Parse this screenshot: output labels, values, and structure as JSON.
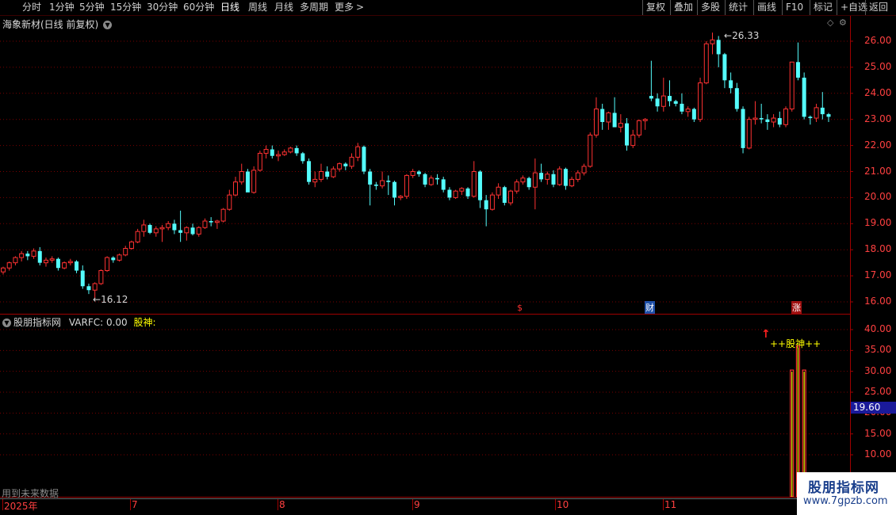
{
  "toolbar": {
    "periods": [
      "分时",
      "1分钟",
      "5分钟",
      "15分钟",
      "30分钟",
      "60分钟",
      "日线",
      "周线",
      "月线",
      "多周期",
      "更多"
    ],
    "active_period": "日线",
    "more_arrow": ">",
    "right_buttons": [
      "复权",
      "叠加",
      "多股",
      "统计",
      "画线",
      "F10",
      "+自选",
      "返回"
    ],
    "secondary_button": "标记"
  },
  "main_chart": {
    "title": "海象新材(日线 前复权)",
    "high_label": "26.33",
    "low_label": "16.12",
    "y_ticks": [
      "26.00",
      "25.00",
      "24.00",
      "23.00",
      "22.00",
      "21.00",
      "20.00",
      "19.00",
      "18.00",
      "17.00",
      "16.00"
    ],
    "event_markers": [
      "$",
      "财",
      "涨"
    ]
  },
  "indicator": {
    "title": "股朋指标网",
    "varfc": "VARFC: 0.00",
    "gushen_label": "股神:",
    "signal_text": "++股神++",
    "y_ticks": [
      "40.00",
      "35.00",
      "30.00",
      "25.00",
      "20.00",
      "15.00",
      "10.00"
    ],
    "current_value": "19.60",
    "footer_note": "用到未来数据"
  },
  "x_axis": {
    "labels": [
      "2025年",
      "7",
      "8",
      "9",
      "10",
      "11"
    ]
  },
  "watermark": {
    "title": "股朋指标网",
    "url": "www.7gpzb.com"
  },
  "colors": {
    "up": "#ff3232",
    "down": "#54fcfc",
    "grid": "#7a0000",
    "axis": "#a00000",
    "yellow": "#ffff00",
    "signal_bar": "#ff3232"
  },
  "chart_data": {
    "type": "candlestick",
    "ylim": [
      15.6,
      26.7
    ],
    "ohlc": [
      [
        17.15,
        17.35,
        17.05,
        17.3
      ],
      [
        17.3,
        17.55,
        17.2,
        17.5
      ],
      [
        17.5,
        17.75,
        17.4,
        17.7
      ],
      [
        17.7,
        17.95,
        17.55,
        17.85
      ],
      [
        17.85,
        17.95,
        17.6,
        17.75
      ],
      [
        17.75,
        18.05,
        17.65,
        17.95
      ],
      [
        17.95,
        18.1,
        17.4,
        17.5
      ],
      [
        17.5,
        17.7,
        17.35,
        17.6
      ],
      [
        17.6,
        17.75,
        17.5,
        17.65
      ],
      [
        17.65,
        17.7,
        17.2,
        17.3
      ],
      [
        17.3,
        17.55,
        17.25,
        17.5
      ],
      [
        17.5,
        17.65,
        17.4,
        17.55
      ],
      [
        17.55,
        17.6,
        17.1,
        17.2
      ],
      [
        17.2,
        17.4,
        16.5,
        16.6
      ],
      [
        16.6,
        16.7,
        16.3,
        16.45
      ],
      [
        16.45,
        16.75,
        16.12,
        16.7
      ],
      [
        16.7,
        17.25,
        16.65,
        17.2
      ],
      [
        17.2,
        17.75,
        17.15,
        17.7
      ],
      [
        17.7,
        17.75,
        17.5,
        17.6
      ],
      [
        17.6,
        17.85,
        17.55,
        17.8
      ],
      [
        17.8,
        18.15,
        17.75,
        18.05
      ],
      [
        18.05,
        18.35,
        18.0,
        18.3
      ],
      [
        18.3,
        18.8,
        18.25,
        18.7
      ],
      [
        18.7,
        19.15,
        18.5,
        18.95
      ],
      [
        18.95,
        19.0,
        18.6,
        18.65
      ],
      [
        18.65,
        18.9,
        18.5,
        18.8
      ],
      [
        18.8,
        18.95,
        18.3,
        18.85
      ],
      [
        18.85,
        19.1,
        18.75,
        19.0
      ],
      [
        19.0,
        19.15,
        18.6,
        18.75
      ],
      [
        18.75,
        19.5,
        18.3,
        18.65
      ],
      [
        18.65,
        18.9,
        18.35,
        18.85
      ],
      [
        18.85,
        19.0,
        18.55,
        18.6
      ],
      [
        18.6,
        18.9,
        18.5,
        18.85
      ],
      [
        18.85,
        19.2,
        18.8,
        19.1
      ],
      [
        19.1,
        19.25,
        18.9,
        19.05
      ],
      [
        19.05,
        19.15,
        18.8,
        19.1
      ],
      [
        19.1,
        19.6,
        19.05,
        19.55
      ],
      [
        19.55,
        20.3,
        19.5,
        20.1
      ],
      [
        20.1,
        20.8,
        20.05,
        20.6
      ],
      [
        20.6,
        21.3,
        20.5,
        21.0
      ],
      [
        21.0,
        21.1,
        20.5,
        20.2
      ],
      [
        20.2,
        21.2,
        20.15,
        21.05
      ],
      [
        21.05,
        21.8,
        21.0,
        21.7
      ],
      [
        21.7,
        22.0,
        21.5,
        21.85
      ],
      [
        21.85,
        22.0,
        21.5,
        21.6
      ],
      [
        21.6,
        21.8,
        21.4,
        21.65
      ],
      [
        21.65,
        21.85,
        21.6,
        21.75
      ],
      [
        21.75,
        21.95,
        21.7,
        21.9
      ],
      [
        21.9,
        22.0,
        21.6,
        21.7
      ],
      [
        21.7,
        21.75,
        21.3,
        21.4
      ],
      [
        21.4,
        21.5,
        20.5,
        20.6
      ],
      [
        20.6,
        21.0,
        20.4,
        20.7
      ],
      [
        20.7,
        21.3,
        20.6,
        21.0
      ],
      [
        21.0,
        21.2,
        20.7,
        20.8
      ],
      [
        20.8,
        21.2,
        20.75,
        21.1
      ],
      [
        21.1,
        21.35,
        21.0,
        21.3
      ],
      [
        21.3,
        21.35,
        21.05,
        21.2
      ],
      [
        21.2,
        21.7,
        21.1,
        21.55
      ],
      [
        21.55,
        22.1,
        21.4,
        21.95
      ],
      [
        21.95,
        22.0,
        20.9,
        21.0
      ],
      [
        21.0,
        21.1,
        19.7,
        20.5
      ],
      [
        20.5,
        20.6,
        20.3,
        20.45
      ],
      [
        20.45,
        21.0,
        20.35,
        20.65
      ],
      [
        20.65,
        20.85,
        20.1,
        20.6
      ],
      [
        20.6,
        20.65,
        19.7,
        20.0
      ],
      [
        20.0,
        20.1,
        19.9,
        20.05
      ],
      [
        20.05,
        20.9,
        19.95,
        20.85
      ],
      [
        20.85,
        21.1,
        20.75,
        21.0
      ],
      [
        21.0,
        21.05,
        20.8,
        20.9
      ],
      [
        20.9,
        20.95,
        20.4,
        20.5
      ],
      [
        20.5,
        20.85,
        20.45,
        20.75
      ],
      [
        20.75,
        20.9,
        20.5,
        20.7
      ],
      [
        20.7,
        20.8,
        20.2,
        20.3
      ],
      [
        20.3,
        20.4,
        19.9,
        20.0
      ],
      [
        20.0,
        20.3,
        19.95,
        20.25
      ],
      [
        20.25,
        20.4,
        20.1,
        20.35
      ],
      [
        20.35,
        20.4,
        19.95,
        20.05
      ],
      [
        20.05,
        21.4,
        20.0,
        21.0
      ],
      [
        21.0,
        21.05,
        19.6,
        19.9
      ],
      [
        19.9,
        20.1,
        18.9,
        19.55
      ],
      [
        19.55,
        20.2,
        19.5,
        20.1
      ],
      [
        20.1,
        20.55,
        19.95,
        20.4
      ],
      [
        20.4,
        20.45,
        19.7,
        19.8
      ],
      [
        19.8,
        20.3,
        19.7,
        20.25
      ],
      [
        20.25,
        20.7,
        20.15,
        20.6
      ],
      [
        20.6,
        20.85,
        20.5,
        20.75
      ],
      [
        20.75,
        20.8,
        20.3,
        20.4
      ],
      [
        20.4,
        21.5,
        19.55,
        20.95
      ],
      [
        20.95,
        21.3,
        20.6,
        20.7
      ],
      [
        20.7,
        21.0,
        20.5,
        20.9
      ],
      [
        20.9,
        21.05,
        20.4,
        20.5
      ],
      [
        20.5,
        21.2,
        20.45,
        21.1
      ],
      [
        21.1,
        21.15,
        20.3,
        20.45
      ],
      [
        20.45,
        20.8,
        20.4,
        20.7
      ],
      [
        20.7,
        21.05,
        20.6,
        20.95
      ],
      [
        20.95,
        21.3,
        20.85,
        21.2
      ],
      [
        21.2,
        22.5,
        21.15,
        22.4
      ],
      [
        22.4,
        23.85,
        22.3,
        23.4
      ],
      [
        23.4,
        23.6,
        22.6,
        22.9
      ],
      [
        22.9,
        23.3,
        22.6,
        23.25
      ],
      [
        23.25,
        23.85,
        22.8,
        22.7
      ],
      [
        22.7,
        23.2,
        22.5,
        22.85
      ],
      [
        22.85,
        23.05,
        21.8,
        22.0
      ],
      [
        22.0,
        22.6,
        21.9,
        22.4
      ],
      [
        22.4,
        23.0,
        22.3,
        22.95
      ],
      [
        22.95,
        23.05,
        22.6,
        23.0
      ],
      [
        23.9,
        25.25,
        23.7,
        23.8
      ],
      [
        23.8,
        24.0,
        23.3,
        23.5
      ],
      [
        23.5,
        24.6,
        23.3,
        23.9
      ],
      [
        23.9,
        24.5,
        23.5,
        23.7
      ],
      [
        23.7,
        23.75,
        23.5,
        23.6
      ],
      [
        23.6,
        24.0,
        23.2,
        23.3
      ],
      [
        23.3,
        23.5,
        23.1,
        23.4
      ],
      [
        23.4,
        23.45,
        22.9,
        23.0
      ],
      [
        23.0,
        24.6,
        22.9,
        24.4
      ],
      [
        24.4,
        26.0,
        24.35,
        25.9
      ],
      [
        25.9,
        26.33,
        25.5,
        26.05
      ],
      [
        26.05,
        26.2,
        25.0,
        25.5
      ],
      [
        25.5,
        25.55,
        24.2,
        24.5
      ],
      [
        24.5,
        24.8,
        24.0,
        24.2
      ],
      [
        24.2,
        24.4,
        23.3,
        23.4
      ],
      [
        23.4,
        23.5,
        21.7,
        21.9
      ],
      [
        21.9,
        23.1,
        21.85,
        23.0
      ],
      [
        23.0,
        23.7,
        22.8,
        23.05
      ],
      [
        23.05,
        23.6,
        22.85,
        23.0
      ],
      [
        23.0,
        23.2,
        22.6,
        22.9
      ],
      [
        22.9,
        23.2,
        22.7,
        23.05
      ],
      [
        23.05,
        23.3,
        22.7,
        22.8
      ],
      [
        22.8,
        23.5,
        22.7,
        23.4
      ],
      [
        23.4,
        25.2,
        23.3,
        25.2
      ],
      [
        25.2,
        25.95,
        24.5,
        24.6
      ],
      [
        24.6,
        24.8,
        23.0,
        23.1
      ],
      [
        23.1,
        23.15,
        22.8,
        23.05
      ],
      [
        23.05,
        23.6,
        22.9,
        23.45
      ],
      [
        23.45,
        24.05,
        23.0,
        23.2
      ],
      [
        23.2,
        23.25,
        22.9,
        23.1
      ]
    ],
    "indicator_bars": [
      {
        "index": 129,
        "value": 30.3
      },
      {
        "index": 130,
        "value": 36.1
      },
      {
        "index": 131,
        "value": 30.3
      }
    ],
    "indicator_ylim": [
      0,
      43
    ]
  }
}
